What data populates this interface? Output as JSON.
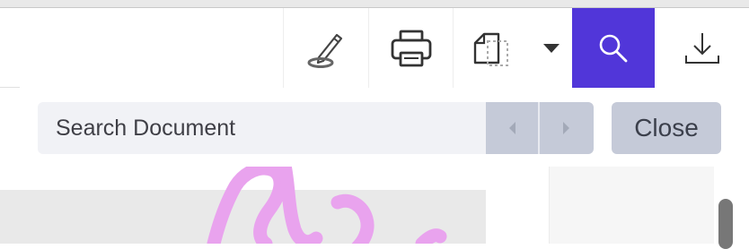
{
  "toolbar": {
    "buttons": [
      {
        "id": "sign",
        "icon": "signature-pen-icon"
      },
      {
        "id": "print",
        "icon": "printer-icon"
      },
      {
        "id": "pages",
        "icon": "copy-pages-icon"
      },
      {
        "id": "more",
        "icon": "caret-down-icon"
      },
      {
        "id": "search",
        "icon": "magnifier-icon",
        "active": true
      },
      {
        "id": "download",
        "icon": "download-icon"
      }
    ],
    "accent_color": "#5136d9"
  },
  "search": {
    "placeholder": "Search Document",
    "close_label": "Close"
  },
  "document": {
    "signature_color": "#e9a3ee"
  }
}
